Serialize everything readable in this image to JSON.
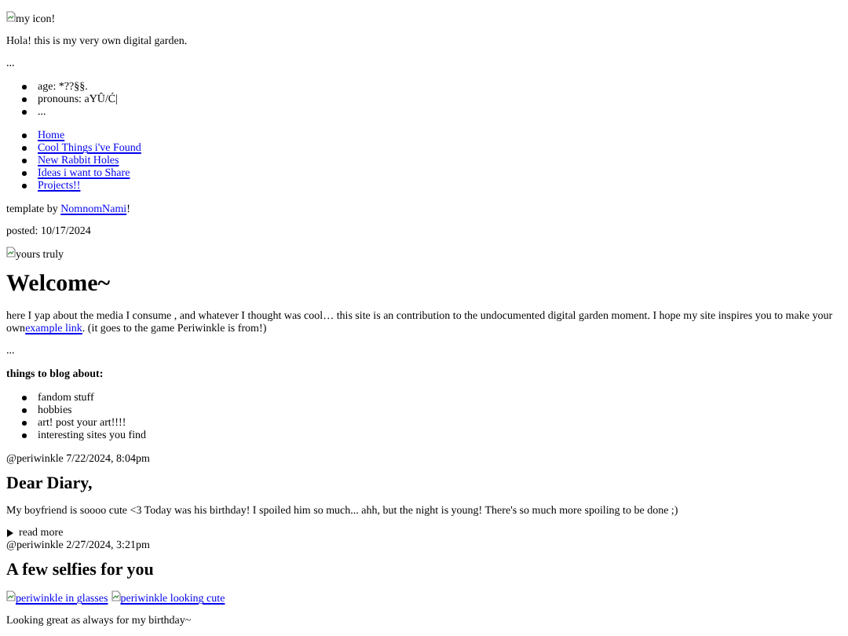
{
  "blocks": [
    {
      "kind": "image",
      "alt": "my icon!"
    },
    {
      "kind": "paragraph",
      "text": "Hola! this is my very own digital garden."
    },
    {
      "kind": "paragraph",
      "text": "..."
    },
    {
      "kind": "list",
      "items": [
        "age: *??§§.",
        "pronouns: aYÛ/Ć|",
        "..."
      ]
    },
    {
      "kind": "link_list",
      "items": [
        "Home",
        "Cool Things i've Found",
        "New Rabbit Holes",
        "Ideas i want to Share",
        "Projects!!"
      ]
    },
    {
      "kind": "link_paragraph",
      "prefix": "template by ",
      "link": "NomnomNami",
      "suffix": "!"
    },
    {
      "kind": "paragraph",
      "text": "posted: 10/17/2024"
    },
    {
      "kind": "image",
      "alt": "yours truly"
    },
    {
      "kind": "title",
      "text": "Welcome~"
    },
    {
      "kind": "link_paragraph",
      "prefix": "here I yap about the media I consume , and whatever I thought was cool… this site is an contribution to the undocumented digital garden moment. I hope my site inspires you to make your own",
      "link": "example link",
      "suffix": ". (it goes to the game Periwinkle is from!)"
    },
    {
      "kind": "paragraph",
      "text": "..."
    },
    {
      "kind": "bold_paragraph",
      "text": "things to blog about:"
    },
    {
      "kind": "list",
      "items": [
        "fandom stuff",
        "hobbies",
        "art! post your art!!!!",
        "interesting sites you find"
      ]
    },
    {
      "kind": "line",
      "text": "@periwinkle 7/22/2024, 8:04pm"
    },
    {
      "kind": "heading",
      "text": "Dear Diary,"
    },
    {
      "kind": "paragraph",
      "text": "My boyfriend is soooo cute <3 Today was his birthday! I spoiled him so much... ahh, but the night is young! There's so much more spoiling to be done ;)"
    },
    {
      "kind": "details",
      "summary": "read more",
      "expanded": false
    },
    {
      "kind": "line",
      "text": "@periwinkle 2/27/2024, 3:21pm"
    },
    {
      "kind": "heading",
      "text": "A few selfies for you"
    },
    {
      "kind": "image_links",
      "items": [
        "periwinkle in glasses",
        "periwinkle looking cute"
      ]
    },
    {
      "kind": "paragraph",
      "text": "Looking great as always for my birthday~"
    }
  ]
}
